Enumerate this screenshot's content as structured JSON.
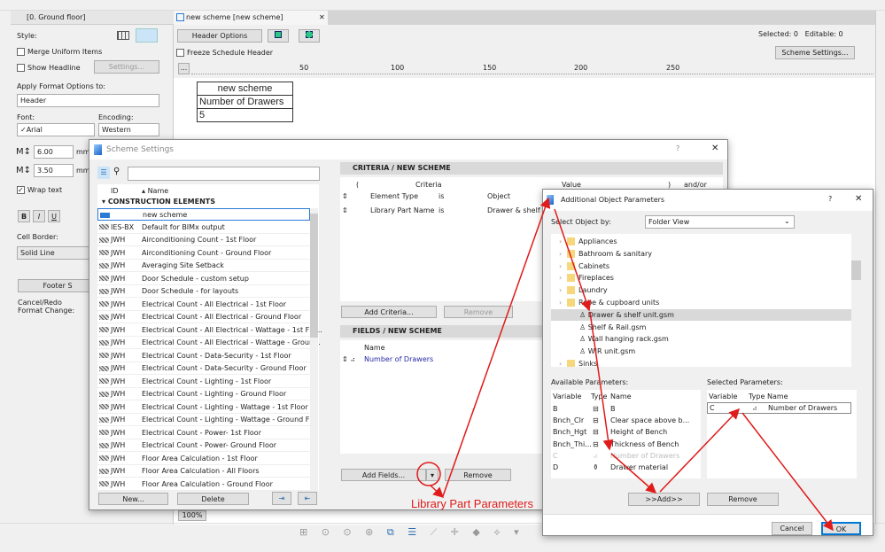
{
  "left_panel": {
    "tab": "[0. Ground floor]",
    "style_label": "Style:",
    "merge_uniform": "Merge Uniform Items",
    "show_headline": "Show Headline",
    "settings_btn": "Settings...",
    "apply_format_label": "Apply Format Options to:",
    "apply_format_value": "Header",
    "font_label": "Font:",
    "font_value": "✓Arial",
    "encoding_label": "Encoding:",
    "encoding_value": "Western",
    "size1": "6.00",
    "size2": "3.50",
    "unit": "mm",
    "wrap_text": "Wrap text",
    "wrap_checked": true,
    "bold": "B",
    "italic": "I",
    "underline": "U",
    "cell_border_label": "Cell Border:",
    "cell_border_value": "Solid Line",
    "footer_btn": "Footer S",
    "cancel_redo": "Cancel/Redo",
    "format_change": "Format Change:"
  },
  "schedule": {
    "tab": "new scheme [new scheme]",
    "header_options": "Header Options",
    "freeze": "Freeze Schedule Header",
    "ruler_dots": "...",
    "ruler_labels": [
      "50",
      "100",
      "150",
      "200",
      "250"
    ],
    "selected_label": "Selected:",
    "selected_value": "0",
    "editable_label": "Editable:",
    "editable_value": "0",
    "scheme_settings_btn": "Scheme Settings...",
    "table": [
      "new scheme",
      "Number of Drawers",
      "5"
    ],
    "zoom": "100%"
  },
  "scheme_dialog": {
    "title": "Scheme Settings",
    "help": "?",
    "col_id": "ID",
    "col_name": "Name",
    "group": "CONSTRUCTION ELEMENTS",
    "rows": [
      {
        "id": "",
        "name": "new scheme"
      },
      {
        "id": "IES-BX",
        "name": "Default for BIMx output"
      },
      {
        "id": "JWH",
        "name": "Airconditioning Count - 1st Floor"
      },
      {
        "id": "JWH",
        "name": "Airconditioning Count - Ground Floor"
      },
      {
        "id": "JWH",
        "name": "Averaging Site Setback"
      },
      {
        "id": "JWH",
        "name": "Door Schedule - custom setup"
      },
      {
        "id": "JWH",
        "name": "Door Schedule - for layouts"
      },
      {
        "id": "JWH",
        "name": "Electrical Count - All Electrical - 1st Floor"
      },
      {
        "id": "JWH",
        "name": "Electrical Count - All Electrical - Ground Floor"
      },
      {
        "id": "JWH",
        "name": "Electrical Count - All Electrical - Wattage - 1st Flo..."
      },
      {
        "id": "JWH",
        "name": "Electrical Count - All Electrical - Wattage - Groun..."
      },
      {
        "id": "JWH",
        "name": "Electrical Count - Data-Security - 1st Floor"
      },
      {
        "id": "JWH",
        "name": "Electrical Count - Data-Security - Ground Floor"
      },
      {
        "id": "JWH",
        "name": "Electrical Count - Lighting - 1st Floor"
      },
      {
        "id": "JWH",
        "name": "Electrical Count - Lighting - Ground Floor"
      },
      {
        "id": "JWH",
        "name": "Electrical Count - Lighting - Wattage - 1st Floor"
      },
      {
        "id": "JWH",
        "name": "Electrical Count - Lighting - Wattage - Ground Fl..."
      },
      {
        "id": "JWH",
        "name": "Electrical Count - Power- 1st Floor"
      },
      {
        "id": "JWH",
        "name": "Electrical Count - Power- Ground Floor"
      },
      {
        "id": "JWH",
        "name": "Floor Area Calculation - 1st Floor"
      },
      {
        "id": "JWH",
        "name": "Floor Area Calculation - All Floors"
      },
      {
        "id": "JWH",
        "name": "Floor Area Calculation - Ground Floor"
      }
    ],
    "new_btn": "New...",
    "delete_btn": "Delete",
    "criteria_header": "CRITERIA /  NEW SCHEME",
    "crit_cols": [
      "(",
      "Criteria",
      "Value",
      ")",
      "and/or"
    ],
    "criteria": [
      {
        "field": "Element Type",
        "op": "is",
        "value": "Object"
      },
      {
        "field": "Library Part Name",
        "op": "is",
        "value": "Drawer & shelf unit"
      }
    ],
    "add_criteria": "Add Criteria...",
    "remove": "Remove",
    "fields_header": "FIELDS /  NEW SCHEME",
    "fields_col": "Name",
    "fields": [
      "Number of Drawers"
    ],
    "add_fields": "Add Fields..."
  },
  "annotation": {
    "text": "Library Part Parameters",
    "color": "#e01b1b"
  },
  "aop_dialog": {
    "title": "Additional Object Parameters",
    "help": "?",
    "select_by_label": "Select Object by:",
    "select_by_value": "Folder View",
    "tree": [
      {
        "label": "Appliances",
        "type": "folder"
      },
      {
        "label": "Bathroom & sanitary",
        "type": "folder"
      },
      {
        "label": "Cabinets",
        "type": "folder"
      },
      {
        "label": "Fireplaces",
        "type": "folder"
      },
      {
        "label": "Laundry",
        "type": "folder"
      },
      {
        "label": "Robe & cupboard units",
        "type": "folder"
      },
      {
        "label": "Drawer & shelf unit.gsm",
        "type": "object",
        "selected": true
      },
      {
        "label": "Shelf & Rail.gsm",
        "type": "object"
      },
      {
        "label": "Wall hanging rack.gsm",
        "type": "object"
      },
      {
        "label": "WIR unit.gsm",
        "type": "object"
      },
      {
        "label": "Sinks",
        "type": "folder"
      }
    ],
    "available_label": "Available Parameters:",
    "selected_label": "Selected Parameters:",
    "cols": [
      "Variable",
      "Type",
      "Name"
    ],
    "available": [
      {
        "var": "B",
        "name": "B"
      },
      {
        "var": "Bnch_Clr",
        "name": "Clear space above b..."
      },
      {
        "var": "Bnch_Hgt",
        "name": "Height of Bench"
      },
      {
        "var": "Bnch_Thi...",
        "name": "Thickness of Bench"
      },
      {
        "var": "C",
        "name": "Number of Drawers",
        "disabled": true
      },
      {
        "var": "D",
        "name": "Drawer material"
      }
    ],
    "selected": [
      {
        "var": "C",
        "name": "Number of Drawers"
      }
    ],
    "add_btn": ">>Add>>",
    "remove_btn": "Remove",
    "cancel_btn": "Cancel",
    "ok_btn": "OK"
  }
}
